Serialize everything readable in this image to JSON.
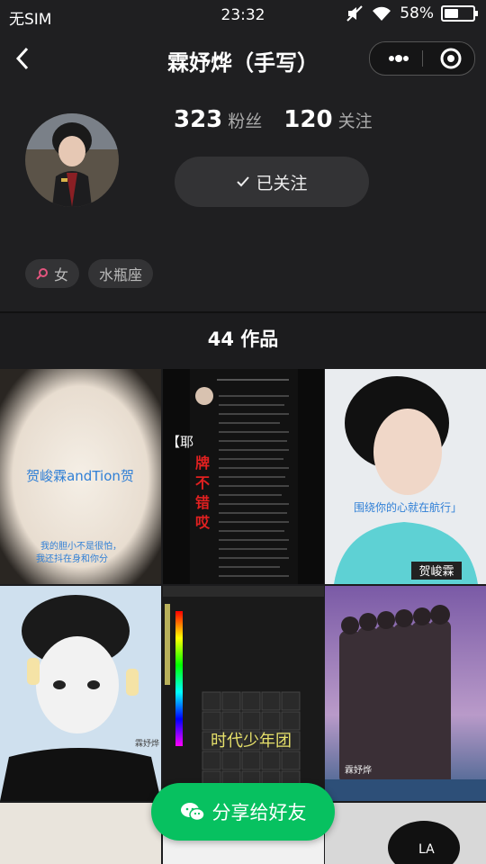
{
  "status_bar": {
    "carrier": "无SIM",
    "time": "23:32",
    "battery": "58%",
    "battery_level": 0.58
  },
  "nav": {
    "title": "霖妤烨（手写）"
  },
  "profile": {
    "fans_count": "323",
    "fans_label": "粉丝",
    "following_count": "120",
    "following_label": "关注",
    "follow_button": "已关注",
    "tags": [
      "女",
      "水瓶座"
    ]
  },
  "works": {
    "count_label": "44 作品"
  },
  "tiles": {
    "t1_line1": "贺峻霖andTion贺",
    "t1_line2": "我的胆小不是很怕，",
    "t1_line3": "我还抖在身和你分",
    "t2_title": "【耶",
    "t2_chars": [
      "牌",
      "不",
      "错",
      "哎"
    ],
    "t3_caption": "围绕你的心就在航行」",
    "t3_name": "贺峻霖",
    "t4_sign": "霖妤烨",
    "t5_title": "时代少年团",
    "t6_sign": "霖妤烨"
  },
  "share_button": "分享给好友"
}
